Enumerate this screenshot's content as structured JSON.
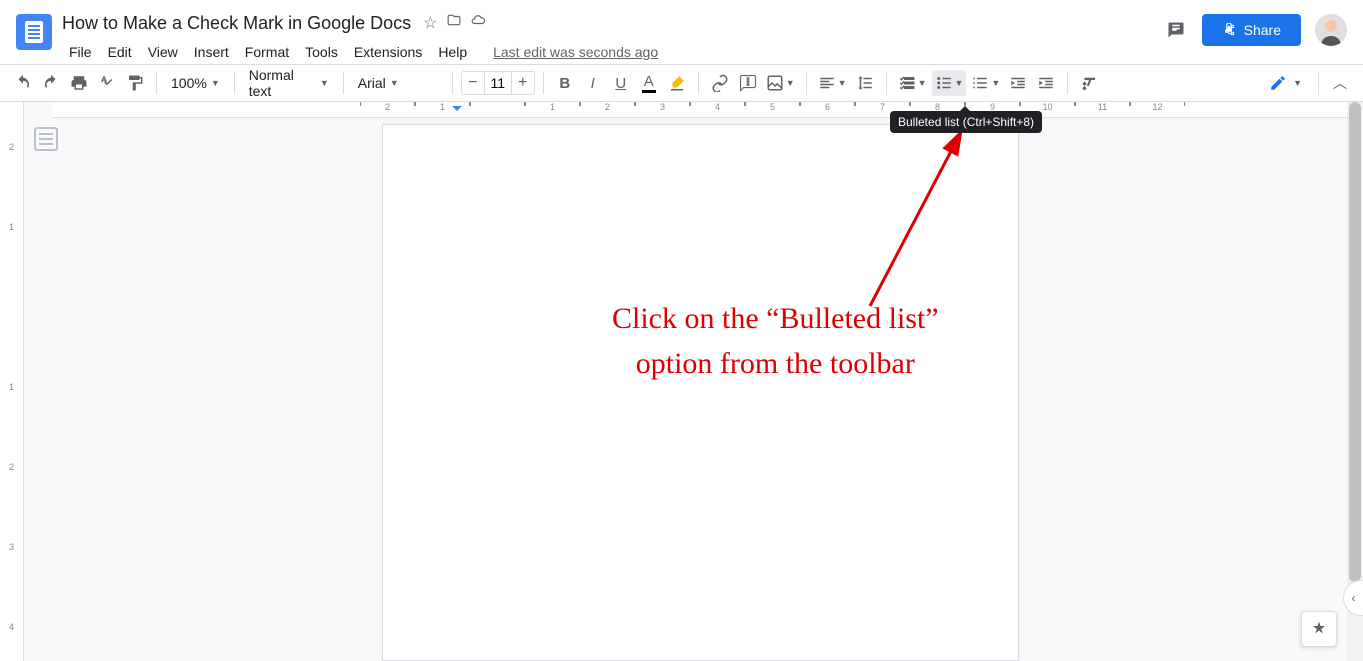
{
  "doc": {
    "title": "How to Make a Check Mark in Google Docs",
    "last_edit": "Last edit was seconds ago"
  },
  "menus": {
    "file": "File",
    "edit": "Edit",
    "view": "View",
    "insert": "Insert",
    "format": "Format",
    "tools": "Tools",
    "extensions": "Extensions",
    "help": "Help"
  },
  "toolbar": {
    "zoom": "100%",
    "style": "Normal text",
    "font": "Arial",
    "font_size": "11"
  },
  "share": {
    "label": "Share"
  },
  "tooltip": {
    "text": "Bulleted list (Ctrl+Shift+8)"
  },
  "ruler": {
    "hnums": [
      "2",
      "1",
      "",
      "1",
      "2",
      "3",
      "4",
      "5",
      "6",
      "7",
      "8",
      "9",
      "10",
      "11",
      "12"
    ],
    "vnums": [
      "",
      "2",
      "",
      "1",
      "",
      "",
      "",
      "1",
      "",
      "2",
      "",
      "3",
      "",
      "4"
    ]
  },
  "annotation": {
    "line1": "Click on the “Bulleted list”",
    "line2": "option from the toolbar"
  }
}
